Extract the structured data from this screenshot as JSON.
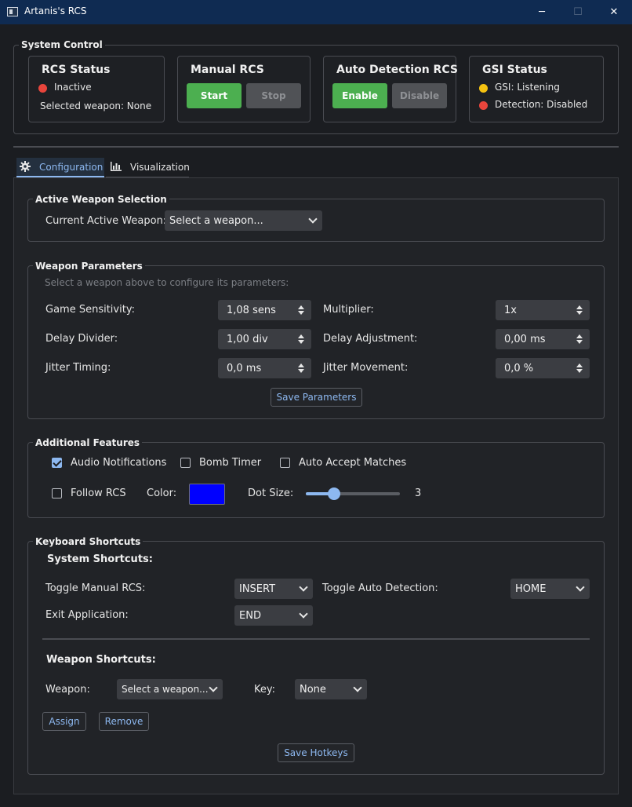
{
  "window": {
    "title": "Artanis's RCS",
    "minimize": "─",
    "maximize": "☐",
    "close": "✕"
  },
  "system_control": {
    "title": "System Control",
    "rcs_status": {
      "title": "RCS Status",
      "state": "Inactive",
      "weapon_label": "Selected weapon: None"
    },
    "manual_rcs": {
      "title": "Manual RCS",
      "start": "Start",
      "stop": "Stop"
    },
    "auto_detection": {
      "title": "Auto Detection RCS",
      "enable": "Enable",
      "disable": "Disable"
    },
    "gsi_status": {
      "title": "GSI Status",
      "gsi": "GSI: Listening",
      "detection": "Detection: Disabled"
    }
  },
  "tabs": [
    {
      "label": "Configuration",
      "icon": "gear-icon",
      "active": true
    },
    {
      "label": "Visualization",
      "icon": "bar-chart-icon",
      "active": false
    }
  ],
  "active_weapon": {
    "title": "Active Weapon Selection",
    "label": "Current Active Weapon:",
    "value": "Select a weapon..."
  },
  "weapon_params": {
    "title": "Weapon Parameters",
    "hint": "Select a weapon above to configure its parameters:",
    "game_sensitivity": {
      "label": "Game Sensitivity:",
      "value": "1,08 sens"
    },
    "multiplier": {
      "label": "Multiplier:",
      "value": "1x"
    },
    "delay_divider": {
      "label": "Delay Divider:",
      "value": "1,00 div"
    },
    "delay_adjustment": {
      "label": "Delay Adjustment:",
      "value": "0,00 ms"
    },
    "jitter_timing": {
      "label": "Jitter Timing:",
      "value": "0,0 ms"
    },
    "jitter_movement": {
      "label": "Jitter Movement:",
      "value": "0,0 %"
    },
    "save": "Save Parameters"
  },
  "features": {
    "title": "Additional Features",
    "audio": {
      "label": "Audio Notifications",
      "checked": true
    },
    "bomb": {
      "label": "Bomb Timer",
      "checked": false
    },
    "auto_accept": {
      "label": "Auto Accept Matches",
      "checked": false
    },
    "follow": {
      "label": "Follow RCS",
      "checked": false
    },
    "color_label": "Color:",
    "color_value": "#0000ff",
    "dot_size_label": "Dot Size:",
    "dot_size_value": "3",
    "dot_size_fraction": 0.27
  },
  "shortcuts": {
    "title": "Keyboard Shortcuts",
    "system_title": "System Shortcuts:",
    "toggle_manual": {
      "label": "Toggle Manual RCS:",
      "value": "INSERT"
    },
    "toggle_auto": {
      "label": "Toggle Auto Detection:",
      "value": "HOME"
    },
    "exit_app": {
      "label": "Exit Application:",
      "value": "END"
    },
    "weapon_title": "Weapon Shortcuts:",
    "weapon_label": "Weapon:",
    "weapon_value": "Select a weapon...",
    "key_label": "Key:",
    "key_value": "None",
    "assign": "Assign",
    "remove": "Remove",
    "save": "Save Hotkeys"
  }
}
